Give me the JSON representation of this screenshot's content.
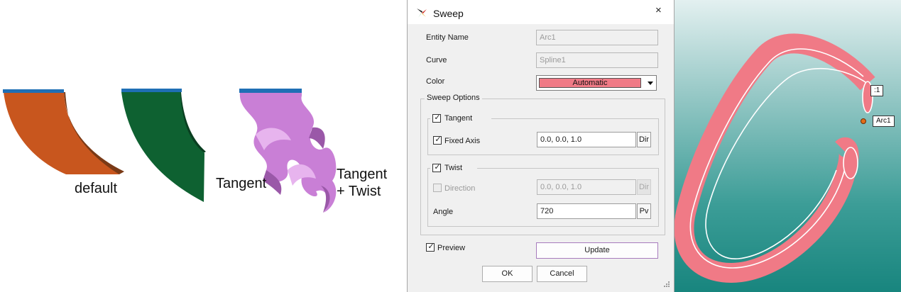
{
  "illustration": {
    "label_default": "default",
    "label_tangent": "Tangent",
    "label_tangent_twist_line1": "Tangent",
    "label_tangent_twist_line2": "+ Twist",
    "colors": {
      "default": "#c8561e",
      "tangent": "#0e6131",
      "twist": "#c97fd6",
      "profile": "#1f6fb5"
    }
  },
  "dialog": {
    "title": "Sweep",
    "close_glyph": "×",
    "entity_name_label": "Entity Name",
    "entity_name_value": "Arc1",
    "curve_label": "Curve",
    "curve_value": "Spline1",
    "color_label": "Color",
    "color_value": "Automatic",
    "color_swatch": "#f07a86",
    "sweep_options_label": "Sweep Options",
    "tangent": {
      "label": "Tangent",
      "checked": true
    },
    "fixed_axis": {
      "label": "Fixed Axis",
      "checked": true,
      "value": "0.0, 0.0, 1.0",
      "button": "Dir"
    },
    "twist": {
      "label": "Twist",
      "checked": true
    },
    "direction": {
      "label": "Direction",
      "checked": false,
      "value": "0.0, 0.0, 1.0",
      "button": "Dir"
    },
    "angle": {
      "label": "Angle",
      "value": "720",
      "button": "Pv"
    },
    "preview": {
      "label": "Preview",
      "checked": true
    },
    "update_button": "Update",
    "ok_button": "OK",
    "cancel_button": "Cancel"
  },
  "viewport": {
    "tag_partial": ":1",
    "tag_arc": "Arc1",
    "ribbon_color": "#f07a86"
  }
}
